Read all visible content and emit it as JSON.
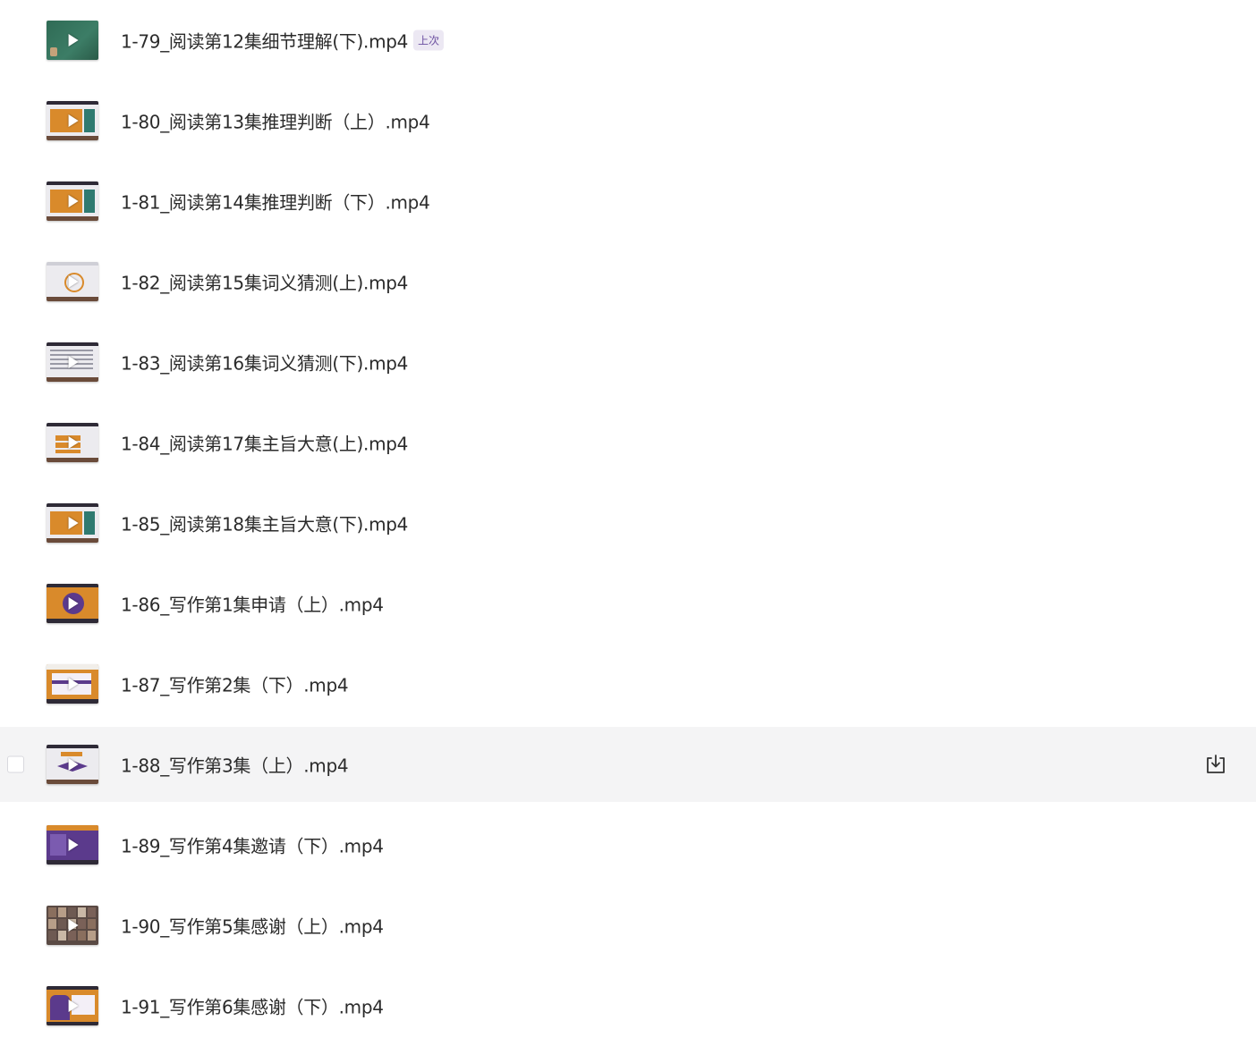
{
  "files": [
    {
      "name": "1-79_阅读第12集细节理解(下).mp4",
      "badge": "上次",
      "thumb": "chalkboard",
      "hover": false
    },
    {
      "name": "1-80_阅读第13集推理判断（上）.mp4",
      "badge": null,
      "thumb": "orange-text",
      "hover": false
    },
    {
      "name": "1-81_阅读第14集推理判断（下）.mp4",
      "badge": null,
      "thumb": "orange-text",
      "hover": false
    },
    {
      "name": "1-82_阅读第15集词义猜测(上).mp4",
      "badge": null,
      "thumb": "white-diagram",
      "hover": false
    },
    {
      "name": "1-83_阅读第16集词义猜测(下).mp4",
      "badge": null,
      "thumb": "white-text",
      "hover": false
    },
    {
      "name": "1-84_阅读第17集主旨大意(上).mp4",
      "badge": null,
      "thumb": "white-orange-blocks",
      "hover": false
    },
    {
      "name": "1-85_阅读第18集主旨大意(下).mp4",
      "badge": null,
      "thumb": "orange-text",
      "hover": false
    },
    {
      "name": "1-86_写作第1集申请（上）.mp4",
      "badge": null,
      "thumb": "orange-purple",
      "hover": false
    },
    {
      "name": "1-87_写作第2集（下）.mp4",
      "badge": null,
      "thumb": "orange-purple-text",
      "hover": false
    },
    {
      "name": "1-88_写作第3集（上）.mp4",
      "badge": null,
      "thumb": "white-purple-shapes",
      "hover": true
    },
    {
      "name": "1-89_写作第4集邀请（下）.mp4",
      "badge": null,
      "thumb": "purple",
      "hover": false
    },
    {
      "name": "1-90_写作第5集感谢（上）.mp4",
      "badge": null,
      "thumb": "photo-grid",
      "hover": false
    },
    {
      "name": "1-91_写作第6集感谢（下）.mp4",
      "badge": null,
      "thumb": "orange-purple-figure",
      "hover": false
    }
  ],
  "icons": {
    "play": "play-icon",
    "download": "download-icon"
  },
  "colors": {
    "hover_row": "#f4f4f5",
    "badge_bg": "#ece8f3",
    "badge_text": "#6b4fa0",
    "thumb_orange": "#d98a2b",
    "thumb_purple": "#5b3a8c",
    "thumb_dark": "#2e2a36"
  }
}
